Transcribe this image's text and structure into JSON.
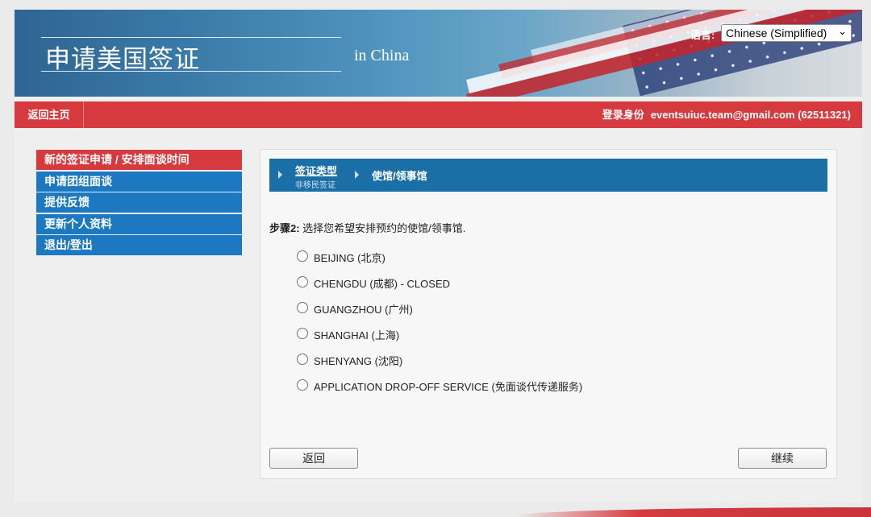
{
  "header": {
    "title": "申请美国签证",
    "subtitle": "in China",
    "language_label": "语言:",
    "language_selected": "Chinese (Simplified)"
  },
  "navbar": {
    "home_label": "返回主页",
    "login_label": "登录身份",
    "login_value": "eventsuiuc.team@gmail.com (62511321)"
  },
  "sidebar": {
    "items": [
      {
        "label": "新的签证申请 / 安排面谈时间",
        "active": true
      },
      {
        "label": "申请团组面谈"
      },
      {
        "label": "提供反馈"
      },
      {
        "label": "更新个人资料"
      },
      {
        "label": "退出/登出"
      }
    ]
  },
  "breadcrumb": {
    "step1_title": "签证类型",
    "step1_sub": "非移民签证",
    "step2_title": "使馆/领事馆"
  },
  "step": {
    "label": "步骤2:",
    "text": " 选择您希望安排预约的使馆/领事馆."
  },
  "options": [
    "BEIJING (北京)",
    "CHENGDU (成都) - CLOSED",
    "GUANGZHOU (广州)",
    "SHANGHAI (上海)",
    "SHENYANG (沈阳)",
    "APPLICATION DROP-OFF SERVICE (免面谈代传递服务)"
  ],
  "buttons": {
    "back": "返回",
    "next": "继续"
  },
  "colors": {
    "nav_red": "#d63a3f",
    "menu_blue": "#1b78c1",
    "crumb_blue": "#1a6fa7"
  }
}
